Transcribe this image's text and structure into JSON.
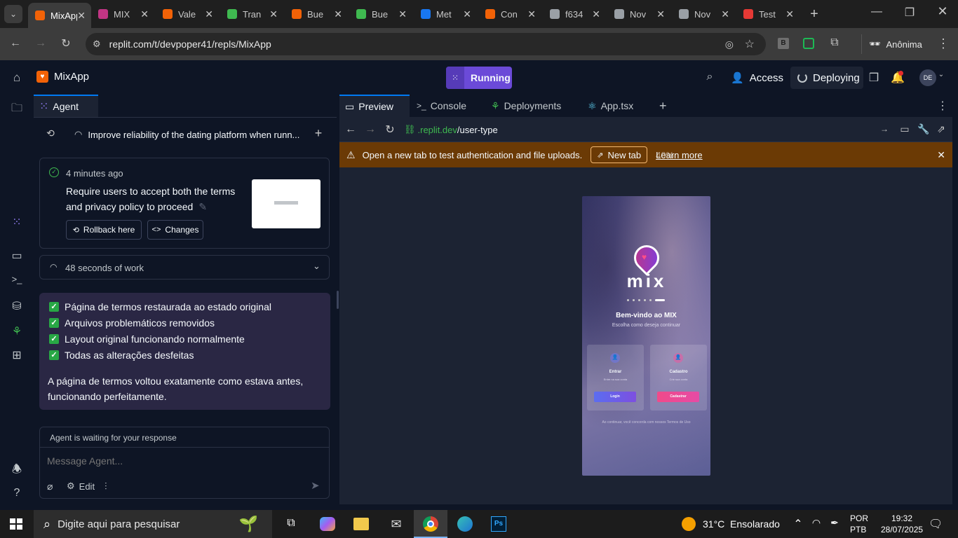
{
  "browser": {
    "tabs": [
      {
        "title": "MixApp",
        "icon": "replit-icon",
        "color": "#f26207",
        "active": true
      },
      {
        "title": "MIX",
        "icon": "mix-icon",
        "color": "#c13584"
      },
      {
        "title": "Vale",
        "icon": "replit-icon",
        "color": "#f26207"
      },
      {
        "title": "Tran",
        "icon": "green-dot-icon",
        "color": "#3fb950"
      },
      {
        "title": "Bue",
        "icon": "replit-icon",
        "color": "#f26207"
      },
      {
        "title": "Bue",
        "icon": "green-dot-icon",
        "color": "#3fb950"
      },
      {
        "title": "Met",
        "icon": "meta-icon",
        "color": "#1877f2"
      },
      {
        "title": "Con",
        "icon": "replit-icon",
        "color": "#f26207"
      },
      {
        "title": "f634",
        "icon": "globe-icon",
        "color": "#9aa0a6"
      },
      {
        "title": "Nov",
        "icon": "incognito-icon",
        "color": "#9aa0a6"
      },
      {
        "title": "Nov",
        "icon": "incognito-icon",
        "color": "#9aa0a6"
      },
      {
        "title": "Test",
        "icon": "gauge-icon",
        "color": "#e53935"
      }
    ],
    "url": "replit.com/t/devpoper41/repls/MixApp",
    "profile": "Anônima"
  },
  "replit": {
    "app_name": "MixApp",
    "status": "Running",
    "access": "Access",
    "deploying": "Deploying",
    "avatar": "DE",
    "accent": "#6b4ad8"
  },
  "agent": {
    "tab_label": "Agent",
    "thread_title": "Improve reliability of the dating platform when runn...",
    "checkpoint": {
      "time": "4 minutes ago",
      "text_line1": "Require users to accept both the terms",
      "text_line2": "and privacy policy to proceed",
      "rollback": "Rollback here",
      "changes": "Changes"
    },
    "work": "48 seconds of work",
    "checklist": [
      "Página de termos restaurada ao estado original",
      "Arquivos problemáticos removidos",
      "Layout original funcionando normalmente",
      "Todas as alterações desfeitas"
    ],
    "summary_line1": "A página de termos voltou exatamente como estava antes,",
    "summary_line2": "funcionando perfeitamente.",
    "waiting": "Agent is waiting for your response",
    "input_placeholder": "Message Agent...",
    "edit_label": "Edit"
  },
  "preview": {
    "tabs": [
      "Preview",
      "Console",
      "Deployments",
      "App.tsx"
    ],
    "url_domain": ".replit.dev",
    "url_path": "/user-type",
    "banner_text": "Open a new tab to test authentication and file uploads.",
    "new_tab": "New tab",
    "learn_more": "Learn more",
    "overlay_text": "40%",
    "app": {
      "logo": "mix",
      "welcome": "Bem-vindo ao MIX",
      "subtitle": "Escolha como deseja continuar",
      "card1_title": "Entrar",
      "card1_sub": "Entre na sua conta",
      "card1_btn": "Login",
      "card2_title": "Cadastro",
      "card2_sub": "Crie sua conta",
      "card2_btn": "Cadastrar",
      "footer": "Ao continuar, você concorda com nossos Termos de Uso"
    }
  },
  "taskbar": {
    "search": "Digite aqui para pesquisar",
    "weather": "31°C  Ensolarado",
    "lang1": "POR",
    "lang2": "PTB",
    "time": "19:32",
    "date": "28/07/2025"
  }
}
